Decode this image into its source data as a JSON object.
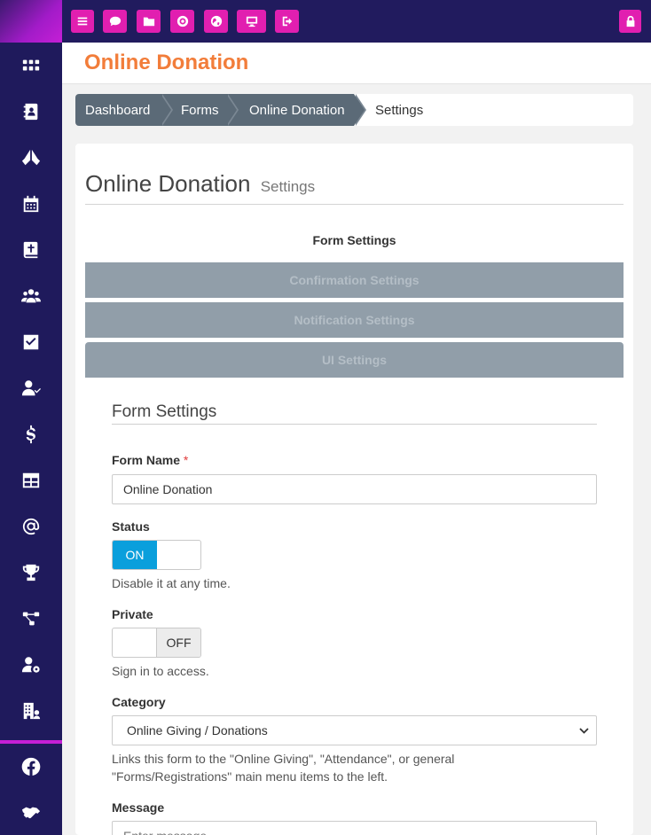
{
  "topbar": {
    "buttons": [
      {
        "icon": "menu-icon"
      },
      {
        "icon": "chat-icon"
      },
      {
        "icon": "folder-icon"
      },
      {
        "icon": "support-icon"
      },
      {
        "icon": "globe-icon"
      },
      {
        "icon": "monitor-icon"
      },
      {
        "icon": "sign-out-icon"
      },
      {
        "icon": "lock-icon"
      }
    ],
    "accent": "#e11fb0"
  },
  "sidebar": {
    "items": [
      {
        "icon": "grid-icon"
      },
      {
        "icon": "address-book-icon"
      },
      {
        "icon": "praying-hands-icon"
      },
      {
        "icon": "calendar-icon"
      },
      {
        "icon": "bible-icon"
      },
      {
        "icon": "users-icon"
      },
      {
        "icon": "checkbox-icon"
      },
      {
        "icon": "user-check-icon"
      },
      {
        "icon": "dollar-icon"
      },
      {
        "icon": "table-icon"
      },
      {
        "icon": "at-icon"
      },
      {
        "icon": "trophy-icon"
      },
      {
        "icon": "sitemap-icon"
      },
      {
        "icon": "user-cog-icon"
      },
      {
        "icon": "building-icon"
      },
      {
        "icon": "facebook-icon"
      },
      {
        "icon": "handshake-icon"
      }
    ],
    "background": "#1f1a5c"
  },
  "page": {
    "title": "Online Donation",
    "title_color": "#f27d3a"
  },
  "breadcrumb": {
    "items": [
      "Dashboard",
      "Forms",
      "Online Donation"
    ],
    "current": "Settings"
  },
  "settings": {
    "heading": "Online Donation",
    "heading_small": "Settings",
    "tabs": {
      "active": "Form Settings",
      "others": [
        "Confirmation Settings",
        "Notification Settings",
        "UI Settings"
      ]
    }
  },
  "form": {
    "section_title": "Form Settings",
    "form_name": {
      "label": "Form Name",
      "required_mark": "*",
      "value": "Online Donation"
    },
    "status": {
      "label": "Status",
      "on_text": "ON",
      "help": "Disable it at any time."
    },
    "private": {
      "label": "Private",
      "off_text": "OFF",
      "help": "Sign in to access."
    },
    "category": {
      "label": "Category",
      "selected": "Online Giving / Donations",
      "help": "Links this form to the \"Online Giving\", \"Attendance\", or general \"Forms/Registrations\" main menu items to the left."
    },
    "message": {
      "label": "Message",
      "placeholder": "Enter message..."
    }
  }
}
